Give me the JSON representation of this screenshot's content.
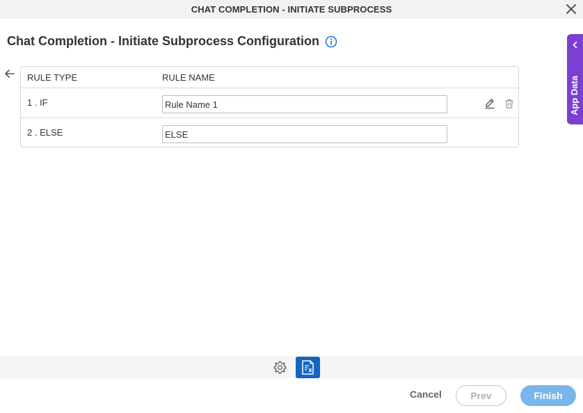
{
  "window": {
    "title": "CHAT COMPLETION - INITIATE SUBPROCESS",
    "close_icon": "close-icon"
  },
  "page": {
    "heading": "Chat Completion - Initiate Subprocess Configuration",
    "info_icon": "info-icon",
    "back_icon": "back-arrow-icon"
  },
  "rules_table": {
    "columns": [
      "RULE TYPE",
      "RULE NAME"
    ],
    "rows": [
      {
        "type": "1 . IF",
        "name": "Rule Name 1",
        "actions": [
          "edit-icon",
          "delete-icon"
        ]
      },
      {
        "type": "2 . ELSE",
        "name": "ELSE",
        "actions": []
      }
    ]
  },
  "app_data_panel": {
    "label": "App Data",
    "icon": "chevron-left-icon",
    "color": "#7b3fd1"
  },
  "toolbar": {
    "icons": [
      "settings-gear-icon",
      "document-mapping-icon"
    ],
    "active_color": "#1565c0"
  },
  "footer": {
    "cancel_label": "Cancel",
    "prev_label": "Prev",
    "finish_label": "Finish",
    "finish_color": "#7ab6ea"
  }
}
